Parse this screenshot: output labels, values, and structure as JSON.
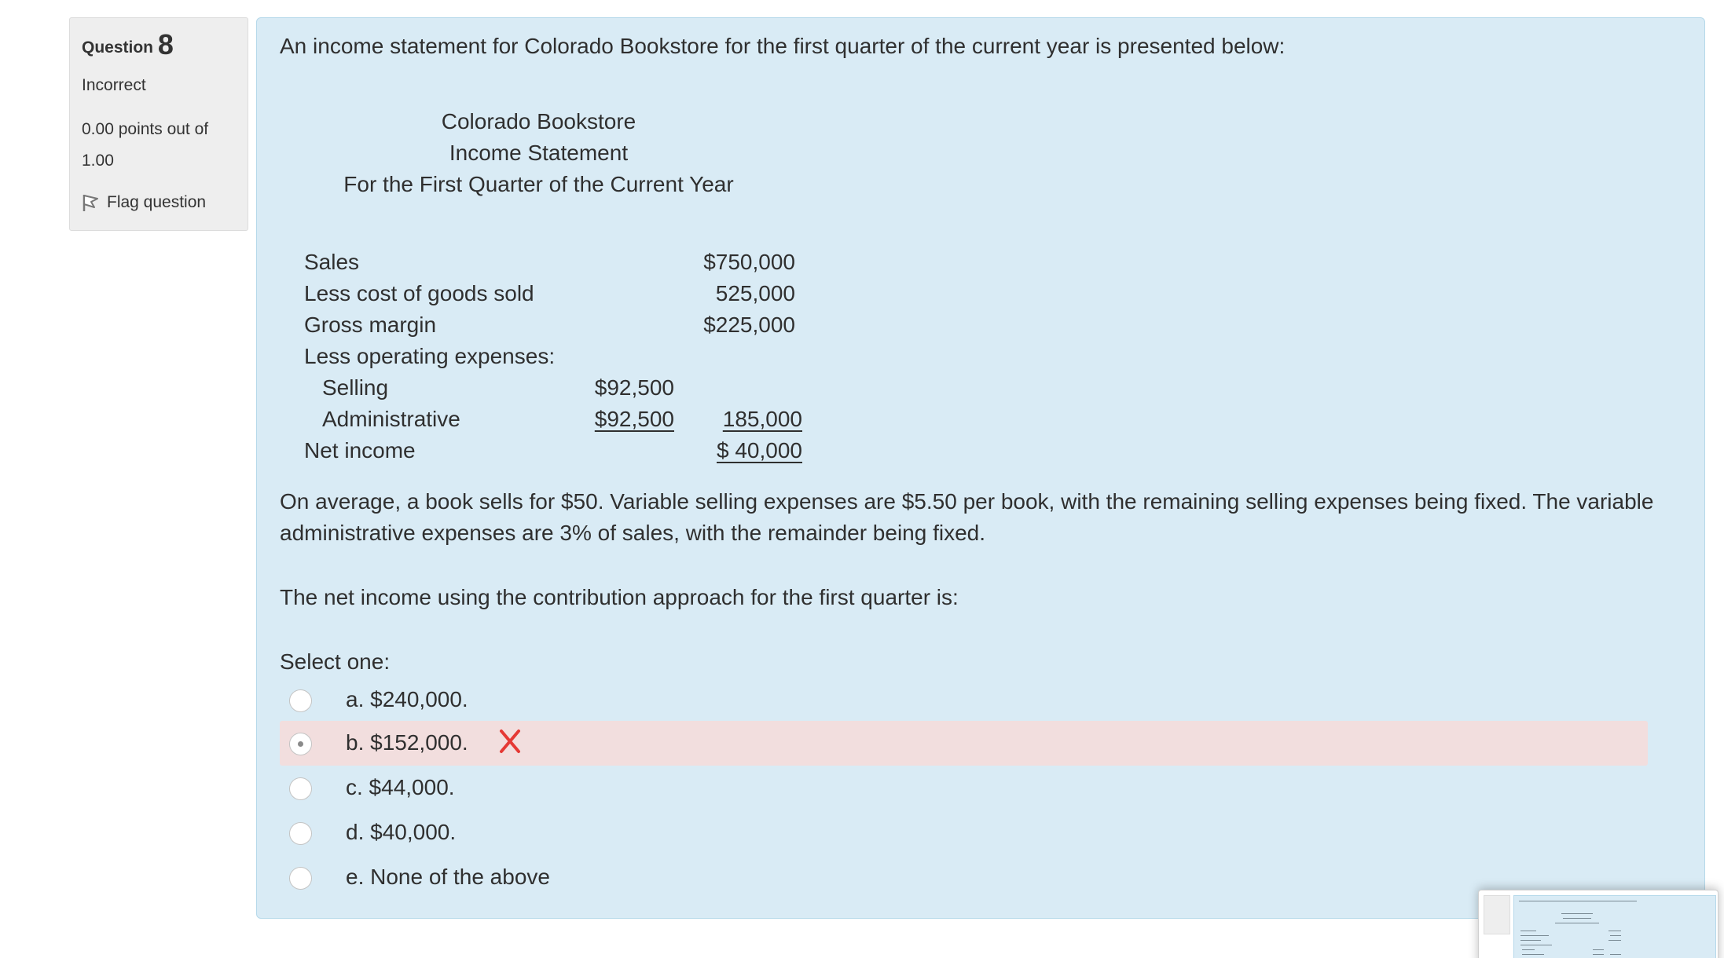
{
  "question_info": {
    "label": "Question",
    "number": "8",
    "state": "Incorrect",
    "grade": "0.00 points out of 1.00",
    "flag_label": "Flag question"
  },
  "question": {
    "intro": "An income statement for Colorado Bookstore for the first quarter of the current year is presented below:",
    "statement_header": {
      "company": "Colorado Bookstore",
      "title": "Income Statement",
      "period": "For the First Quarter of the Current Year"
    },
    "statement_rows": [
      {
        "label": "Sales",
        "col1": "",
        "col2": "$750,000"
      },
      {
        "label": "Less cost of goods sold",
        "col1": "",
        "col2": "525,000"
      },
      {
        "label": "Gross margin",
        "col1": "",
        "col2": "$225,000"
      },
      {
        "label": "Less operating expenses:",
        "col1": "",
        "col2": ""
      },
      {
        "label": "Selling",
        "col1": "$92,500",
        "col2": ""
      },
      {
        "label": "Administrative",
        "col1": "$92,500",
        "col2": "185,000"
      },
      {
        "label": "Net income",
        "col1": "",
        "col2": "$ 40,000"
      }
    ],
    "paragraph": "On average, a book sells for $50. Variable selling expenses are $5.50 per book, with the remaining selling expenses being fixed. The variable administrative expenses are 3% of sales, with the remainder being fixed.",
    "ask": "The net income using the contribution approach for the first quarter is:",
    "select_prompt": "Select one:",
    "options": [
      {
        "text": "a. $240,000.",
        "selected": false
      },
      {
        "text": "b. $152,000.",
        "selected": true,
        "feedback": "incorrect"
      },
      {
        "text": "c. $44,000.",
        "selected": false
      },
      {
        "text": "d. $40,000.",
        "selected": false
      },
      {
        "text": "e. None of the above",
        "selected": false
      }
    ]
  },
  "colors": {
    "content_bg": "#d9ebf5",
    "info_bg": "#eeeeee",
    "incorrect_bg": "#f2dede",
    "incorrect_mark": "#e53935"
  },
  "icons": {
    "flag": "flag-icon",
    "incorrect": "cross-icon"
  }
}
